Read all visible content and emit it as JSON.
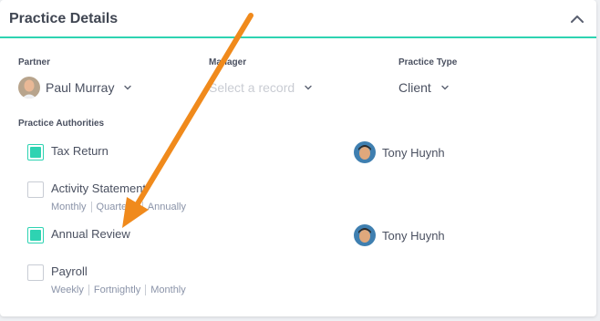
{
  "panel": {
    "title": "Practice Details"
  },
  "fields": {
    "partner": {
      "label": "Partner",
      "value": "Paul Murray"
    },
    "manager": {
      "label": "Manager",
      "placeholder": "Select a record"
    },
    "practice_type": {
      "label": "Practice Type",
      "value": "Client"
    }
  },
  "authorities": {
    "label": "Practice Authorities",
    "items": [
      {
        "label": "Tax Return",
        "checked": true,
        "assignee": "Tony Huynh",
        "options": []
      },
      {
        "label": "Activity Statement",
        "checked": false,
        "assignee": "",
        "options": [
          "Monthly",
          "Quarterly",
          "Annually"
        ]
      },
      {
        "label": "Annual Review",
        "checked": true,
        "assignee": "Tony Huynh",
        "options": []
      },
      {
        "label": "Payroll",
        "checked": false,
        "assignee": "",
        "options": [
          "Weekly",
          "Fortnightly",
          "Monthly"
        ]
      }
    ]
  },
  "colors": {
    "accent": "#2ed3b2",
    "annotation_arrow": "#f08a1c"
  },
  "icons": {
    "collapse": "chevron-up-icon",
    "dropdown": "chevron-down-icon"
  }
}
